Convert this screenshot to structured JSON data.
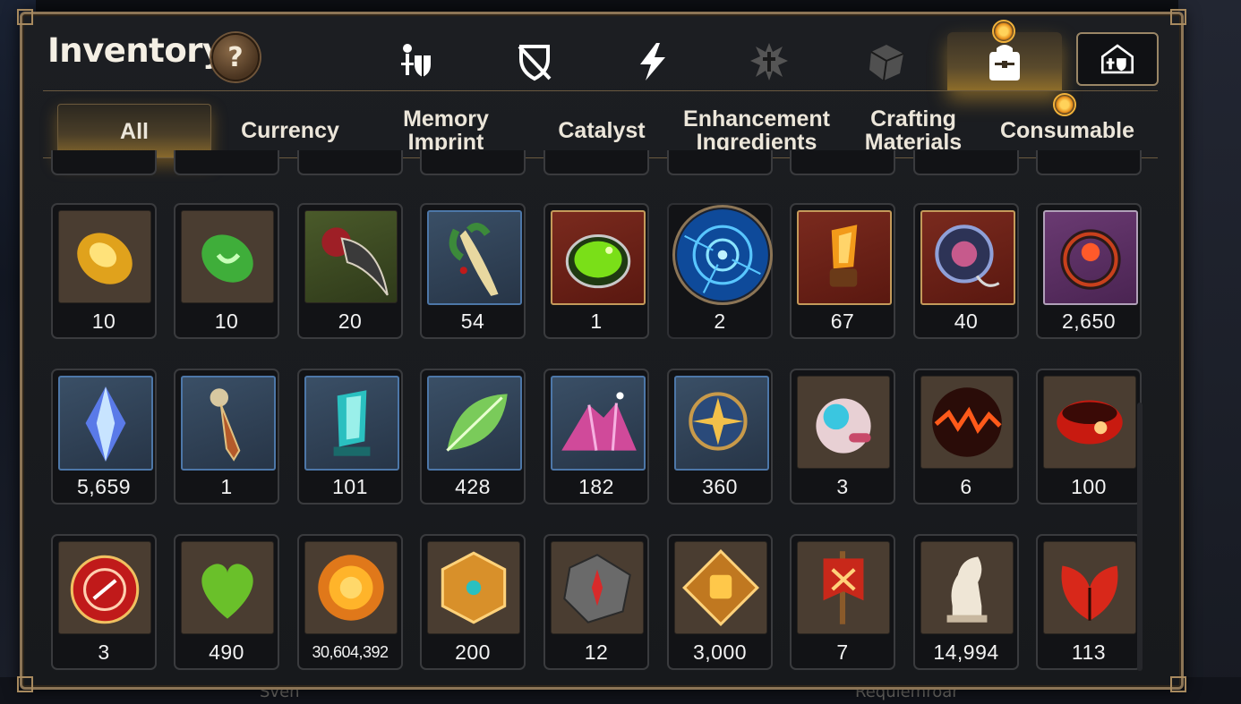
{
  "window": {
    "title": "Inventory",
    "help_label": "?"
  },
  "background": {
    "bottom_left": "Sven",
    "bottom_right": "Requiemroar"
  },
  "top_icons": [
    {
      "name": "hero-gear-icon",
      "active": false
    },
    {
      "name": "shield-crossed-icon",
      "active": false
    },
    {
      "name": "lightning-icon",
      "active": false
    },
    {
      "name": "splatter-emblem-icon",
      "active": false
    },
    {
      "name": "cube-icon",
      "active": false
    },
    {
      "name": "backpack-icon",
      "active": true
    },
    {
      "name": "storage-house-icon",
      "active": false
    }
  ],
  "tabs": [
    {
      "label": "All",
      "active": true
    },
    {
      "label": "Currency",
      "active": false
    },
    {
      "label": "Memory Imprint",
      "active": false
    },
    {
      "label": "Catalyst",
      "active": false
    },
    {
      "label": "Enhancement Ingredients",
      "active": false
    },
    {
      "label": "Crafting Materials",
      "active": false
    },
    {
      "label": "Consumable",
      "active": false,
      "notification": true
    }
  ],
  "items": [
    [
      {
        "icon": "amber-gem-icon",
        "qty": "10"
      },
      {
        "icon": "green-rune-gem-icon",
        "qty": "10"
      },
      {
        "icon": "beast-claw-icon",
        "qty": "20"
      },
      {
        "icon": "ginseng-root-icon",
        "qty": "54"
      },
      {
        "icon": "green-potion-jar-icon",
        "qty": "1"
      },
      {
        "icon": "blue-rune-orb-icon",
        "qty": "2"
      },
      {
        "icon": "flame-crystal-icon",
        "qty": "67"
      },
      {
        "icon": "spiked-ring-icon",
        "qty": "40"
      },
      {
        "icon": "flower-ring-icon",
        "qty": "2,650"
      }
    ],
    [
      {
        "icon": "blue-crystal-icon",
        "qty": "5,659"
      },
      {
        "icon": "pendulum-key-icon",
        "qty": "1"
      },
      {
        "icon": "cyan-prism-icon",
        "qty": "101"
      },
      {
        "icon": "glowing-leaf-icon",
        "qty": "428"
      },
      {
        "icon": "pink-crystal-pile-icon",
        "qty": "182"
      },
      {
        "icon": "star-amulet-icon",
        "qty": "360"
      },
      {
        "icon": "robot-orb-icon",
        "qty": "3"
      },
      {
        "icon": "lava-orb-icon",
        "qty": "6"
      },
      {
        "icon": "red-band-icon",
        "qty": "100"
      }
    ],
    [
      {
        "icon": "red-seal-badge-icon",
        "qty": "3"
      },
      {
        "icon": "green-heart-icon",
        "qty": "490"
      },
      {
        "icon": "sun-coin-icon",
        "qty": "30,604,392"
      },
      {
        "icon": "golden-crest-icon",
        "qty": "200"
      },
      {
        "icon": "compass-stone-icon",
        "qty": "12"
      },
      {
        "icon": "fist-emblem-icon",
        "qty": "3,000"
      },
      {
        "icon": "war-banner-icon",
        "qty": "7"
      },
      {
        "icon": "knight-chess-icon",
        "qty": "14,994"
      },
      {
        "icon": "red-leaf-icon",
        "qty": "113"
      }
    ]
  ],
  "colors": {
    "accent": "#f0b23a",
    "frame": "#8c7556",
    "slot_border": "#3a3b3e",
    "rarity_blue": "#4d77a8"
  }
}
